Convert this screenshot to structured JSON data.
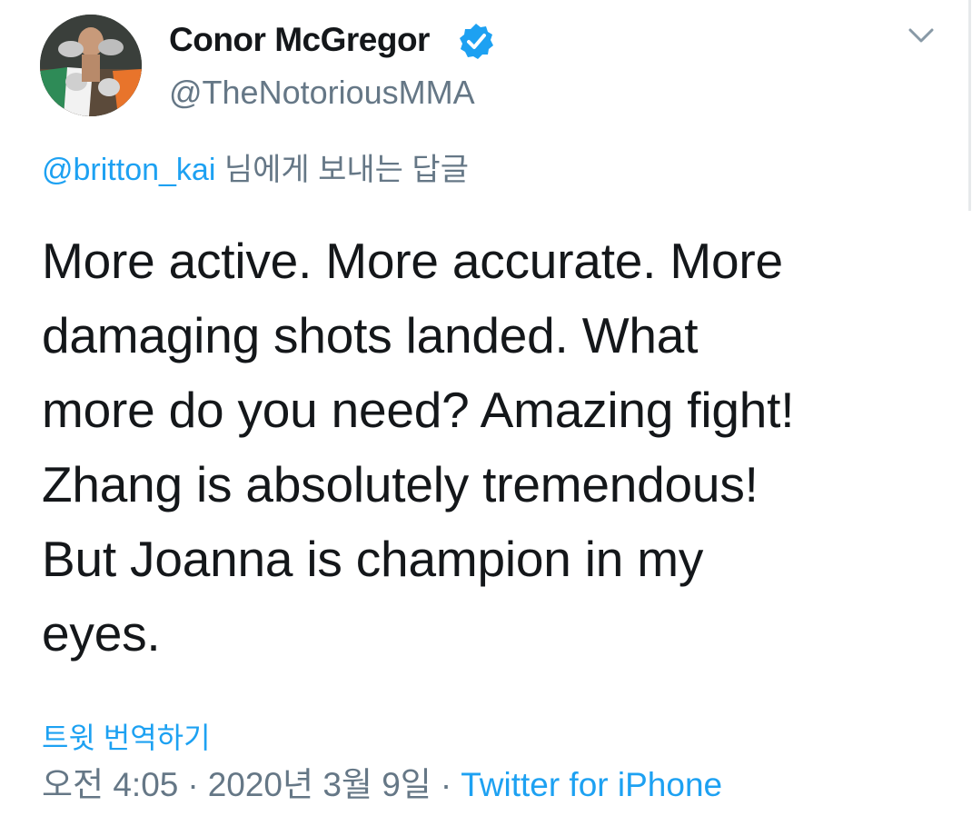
{
  "author": {
    "display_name": "Conor McGregor",
    "handle": "@TheNotoriousMMA",
    "verified": true
  },
  "reply": {
    "mention": "@britton_kai",
    "suffix": " 님에게 보내는 답글"
  },
  "tweet": {
    "lines": [
      "More active. More accurate. More",
      "damaging shots landed. What",
      "more do you need? Amazing fight!",
      "Zhang is absolutely tremendous!",
      "But Joanna is champion in my",
      "eyes."
    ]
  },
  "actions": {
    "translate_label": "트윗 번역하기"
  },
  "meta": {
    "time": "오전 4:05",
    "separator": "·",
    "date": "2020년 3월 9일",
    "source": "Twitter for iPhone"
  },
  "icons": {
    "verified": "verified-badge-icon",
    "menu": "chevron-down-icon"
  },
  "colors": {
    "link": "#1da1f2",
    "secondary_text": "#657786",
    "primary_text": "#14171a"
  }
}
